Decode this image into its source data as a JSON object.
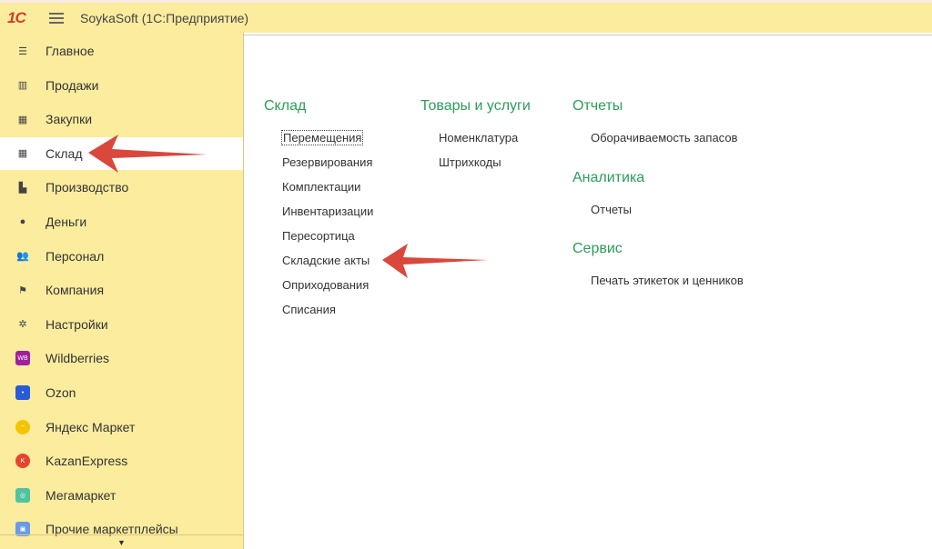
{
  "header": {
    "logo": "1С",
    "title": "SoykaSoft  (1С:Предприятие)"
  },
  "sidebar": {
    "items": [
      {
        "label": "Главное",
        "icon": "list-icon"
      },
      {
        "label": "Продажи",
        "icon": "basket-icon"
      },
      {
        "label": "Закупки",
        "icon": "cart-icon"
      },
      {
        "label": "Склад",
        "icon": "warehouse-icon",
        "selected": true
      },
      {
        "label": "Производство",
        "icon": "factory-icon"
      },
      {
        "label": "Деньги",
        "icon": "ruble-icon"
      },
      {
        "label": "Персонал",
        "icon": "people-icon"
      },
      {
        "label": "Компания",
        "icon": "flag-icon"
      },
      {
        "label": "Настройки",
        "icon": "gear-icon"
      },
      {
        "label": "Wildberries",
        "icon": "wildberries-icon"
      },
      {
        "label": "Ozon",
        "icon": "ozon-icon"
      },
      {
        "label": "Яндекс Маркет",
        "icon": "yandex-market-icon"
      },
      {
        "label": "KazanExpress",
        "icon": "kazanexpress-icon"
      },
      {
        "label": "Мегамаркет",
        "icon": "megamarket-icon"
      },
      {
        "label": "Прочие маркетплейсы",
        "icon": "store-icon"
      }
    ]
  },
  "sections": {
    "sklad": {
      "title": "Склад",
      "links": [
        "Перемещения",
        "Резервирования",
        "Комплектации",
        "Инвентаризации",
        "Пересортица",
        "Складские акты",
        "Оприходования",
        "Списания"
      ]
    },
    "goods": {
      "title": "Товары и услуги",
      "links": [
        "Номенклатура",
        "Штрихкоды"
      ]
    },
    "reports": {
      "title": "Отчеты",
      "links": [
        "Оборачиваемость запасов"
      ]
    },
    "analytics": {
      "title": "Аналитика",
      "links": [
        "Отчеты"
      ]
    },
    "service": {
      "title": "Сервис",
      "links": [
        "Печать этикеток и ценников"
      ]
    }
  },
  "colors": {
    "sidebar": "#fbec9e",
    "heading": "#2d9c5a",
    "arrow": "#d9483b"
  }
}
